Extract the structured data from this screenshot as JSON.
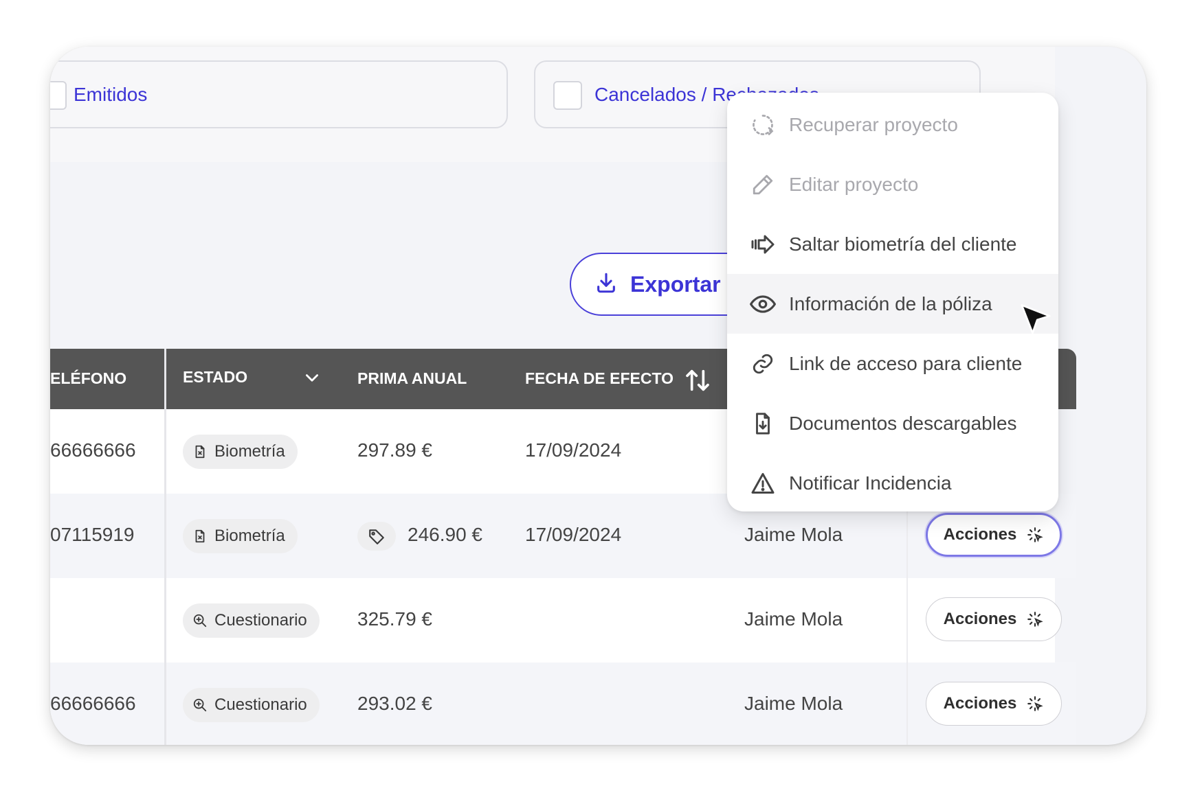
{
  "filters": {
    "emitidos": "Emitidos",
    "cancelados": "Cancelados / Rechazados"
  },
  "export_button": {
    "label": "Exportar C"
  },
  "table": {
    "headers": {
      "telefono": "ELÉFONO",
      "estado": "ESTADO",
      "prima": "PRIMA ANUAL",
      "fecha": "FECHA DE EFECTO"
    },
    "rows": [
      {
        "telefono": "66666666",
        "estado": "Biometría",
        "prima": "297.89 €",
        "fecha": "17/09/2024",
        "agente": "",
        "action": "Acciones"
      },
      {
        "telefono": "07115919",
        "estado": "Biometría",
        "prima": "246.90 €",
        "fecha": "17/09/2024",
        "agente": "Jaime Mola",
        "action": "Acciones"
      },
      {
        "telefono": "",
        "estado": "Cuestionario",
        "prima": "325.79 €",
        "fecha": "",
        "agente": "Jaime Mola",
        "action": "Acciones"
      },
      {
        "telefono": "66666666",
        "estado": "Cuestionario",
        "prima": "293.02 €",
        "fecha": "",
        "agente": "Jaime Mola",
        "action": "Acciones"
      }
    ]
  },
  "actions_menu": {
    "items": [
      {
        "label": "Recuperar proyecto",
        "icon": "restore-icon",
        "enabled": false
      },
      {
        "label": "Editar proyecto",
        "icon": "pencil-icon",
        "enabled": false
      },
      {
        "label": "Saltar biometría del cliente",
        "icon": "skip-arrow-icon",
        "enabled": true
      },
      {
        "label": "Información de la póliza",
        "icon": "eye-icon",
        "enabled": true,
        "hovered": true
      },
      {
        "label": "Link de acceso para cliente",
        "icon": "link-icon",
        "enabled": true
      },
      {
        "label": "Documentos descargables",
        "icon": "document-download-icon",
        "enabled": true
      },
      {
        "label": "Notificar Incidencia",
        "icon": "warning-icon",
        "enabled": true
      }
    ]
  },
  "colors": {
    "accent": "#3c34d6",
    "header_bg": "#555555",
    "menu_hover": "#f4f4f6",
    "disabled_text": "#a8a8ad"
  }
}
